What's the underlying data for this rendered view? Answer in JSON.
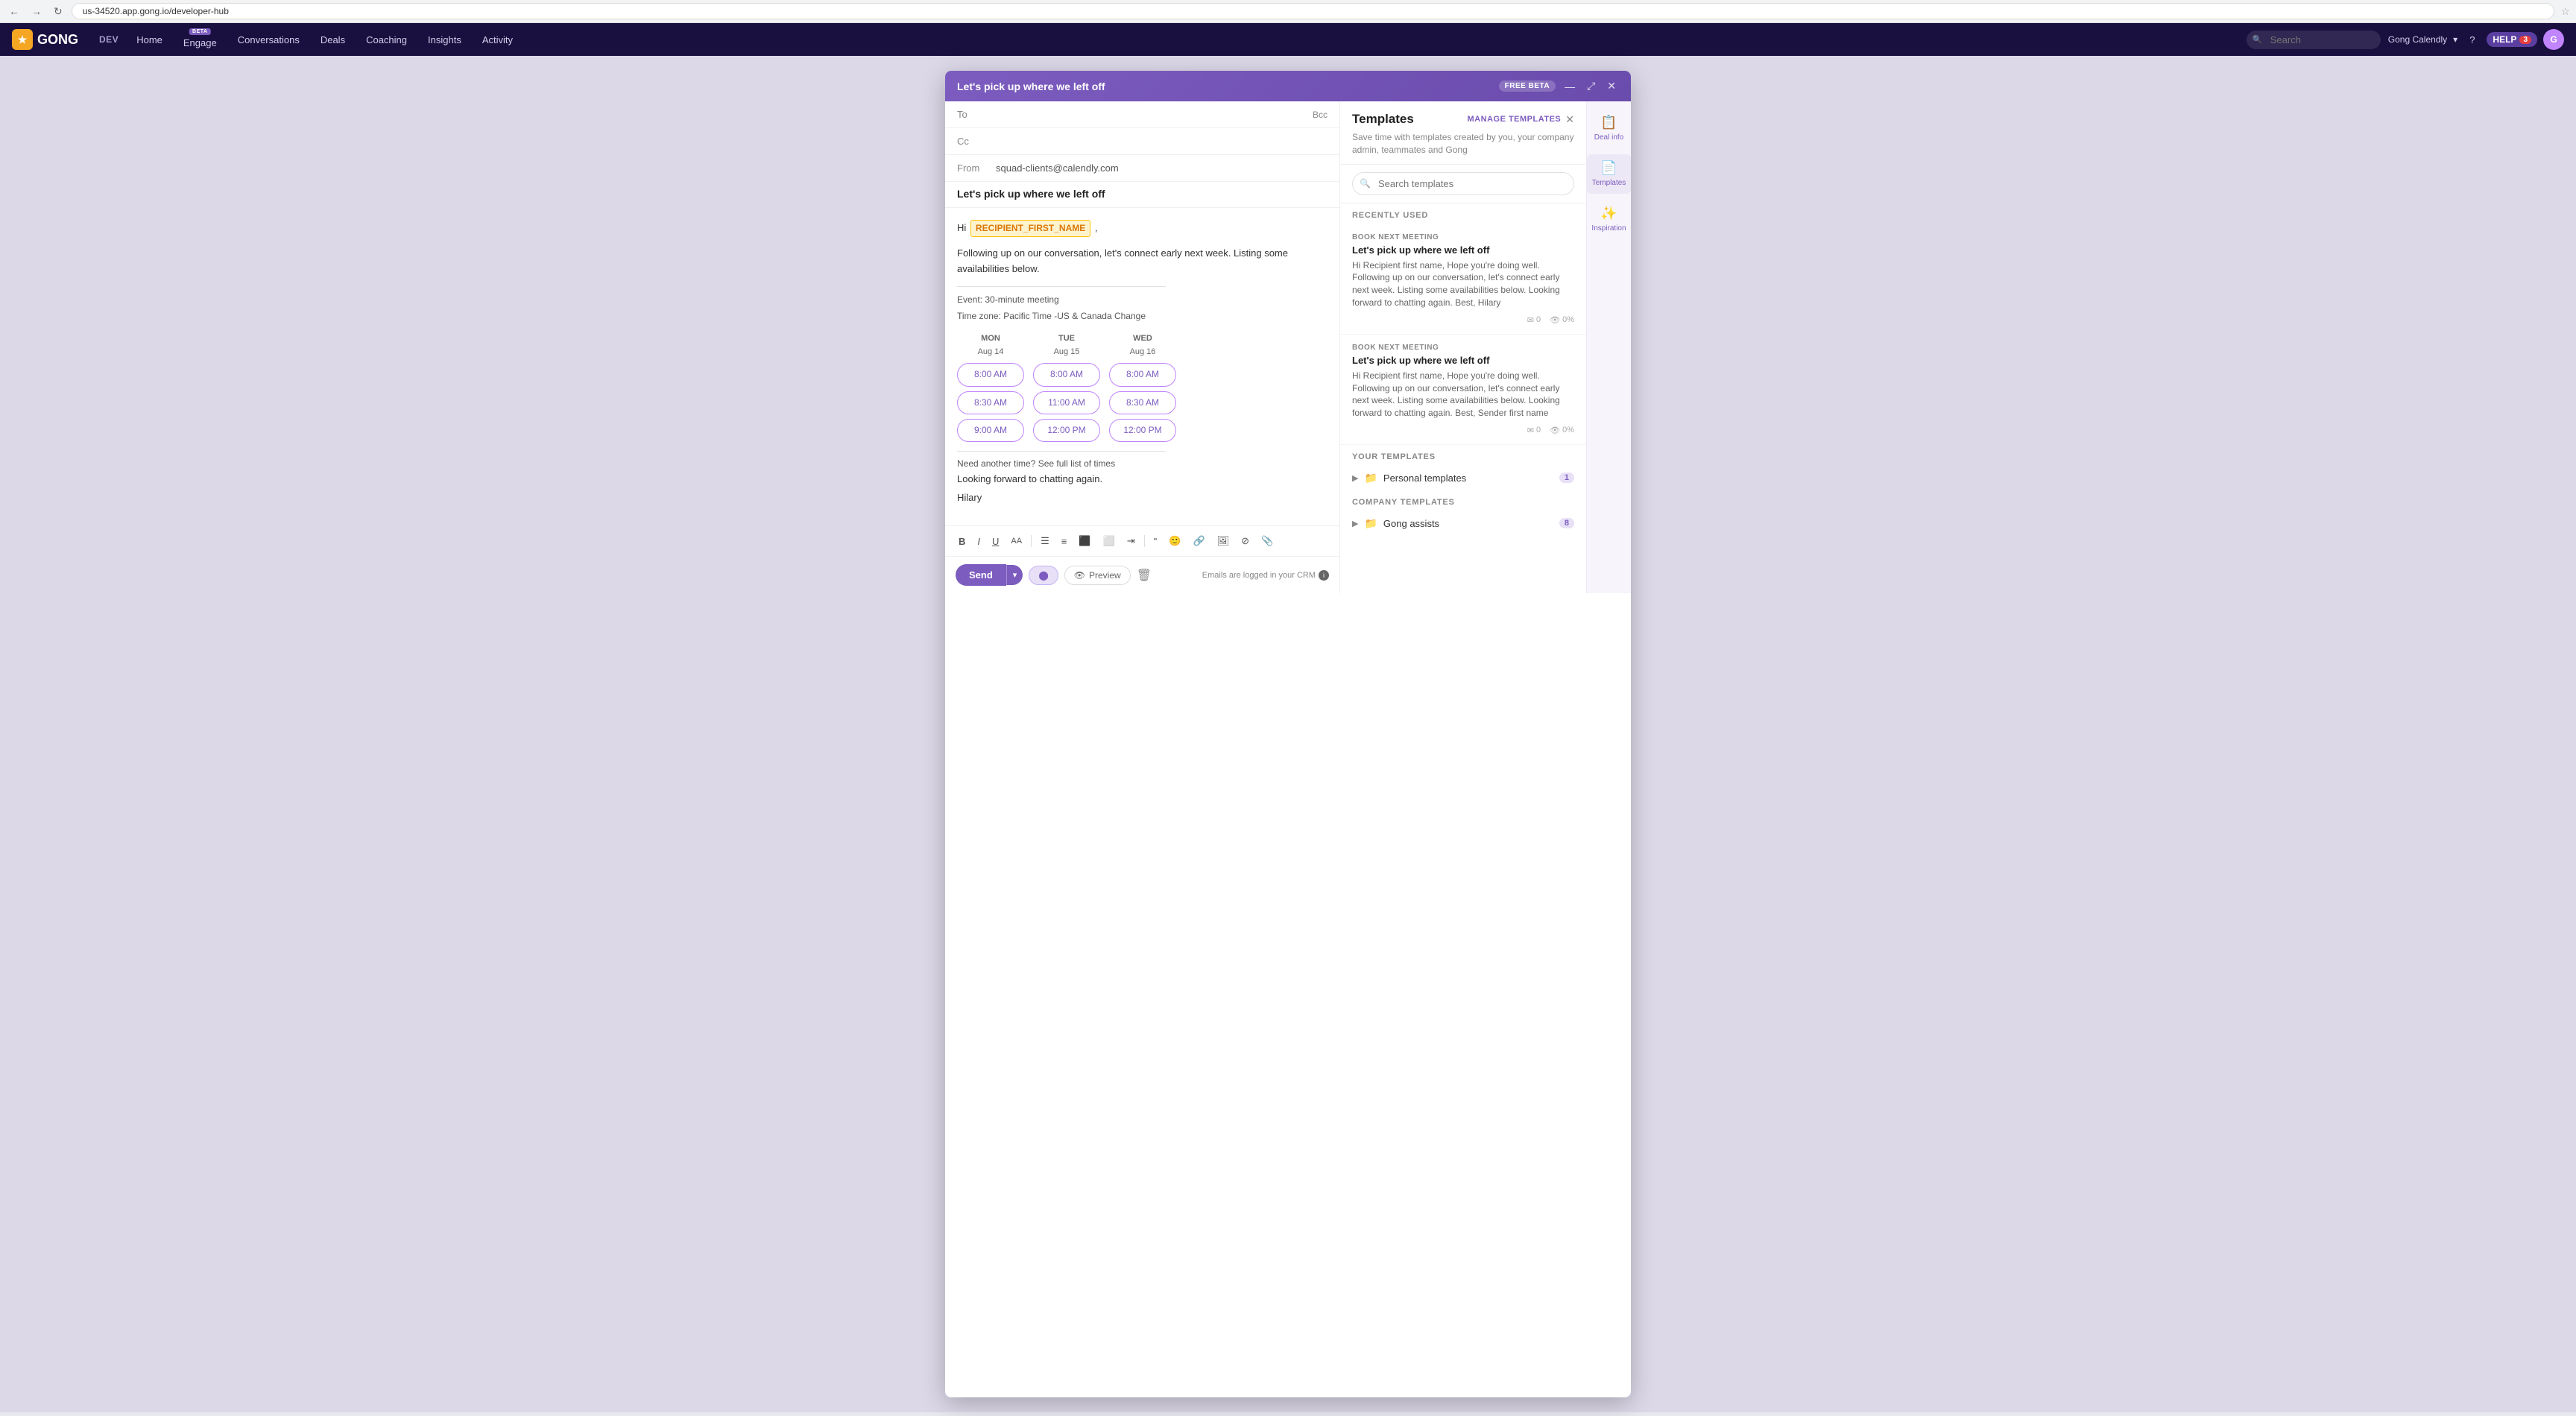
{
  "browser": {
    "url": "us-34520.app.gong.io/developer-hub",
    "back_btn": "←",
    "forward_btn": "→",
    "refresh_btn": "↻"
  },
  "nav": {
    "logo_text": "GONG",
    "env_label": "DEV",
    "items": [
      {
        "label": "Home",
        "beta": false
      },
      {
        "label": "Engage",
        "beta": true
      },
      {
        "label": "Conversations",
        "beta": false
      },
      {
        "label": "Deals",
        "beta": false
      },
      {
        "label": "Coaching",
        "beta": false
      },
      {
        "label": "Insights",
        "beta": false
      },
      {
        "label": "Activity",
        "beta": false
      }
    ],
    "search_placeholder": "Search",
    "user_name": "Gong Calendly",
    "help_label": "HELP",
    "help_count": "3"
  },
  "modal": {
    "title": "Let's pick up where we left off",
    "free_beta": "FREE BETA",
    "compose": {
      "to_label": "To",
      "cc_label": "Cc",
      "bcc_label": "Bcc",
      "from_label": "From",
      "from_email": "squad-clients@calendly.com",
      "subject": "Let's pick up where we left off",
      "greeting": "Hi",
      "recipient_tag": "RECIPIENT_FIRST_NAME",
      "body_line1": "Following up on our conversation, let's connect early next week. Listing some availabilities below.",
      "event_label": "Event: 30-minute meeting",
      "timezone_label": "Time zone: Pacific Time -US & Canada Change",
      "availability": {
        "days": [
          {
            "day": "MON",
            "date": "Aug 14"
          },
          {
            "day": "TUE",
            "date": "Aug 15"
          },
          {
            "day": "WED",
            "date": "Aug 16"
          }
        ],
        "slots": [
          [
            "8:00 AM",
            "8:00 AM",
            "8:00 AM"
          ],
          [
            "8:30 AM",
            "11:00 AM",
            "8:30 AM"
          ],
          [
            "9:00 AM",
            "12:00 PM",
            "12:00 PM"
          ]
        ]
      },
      "need_another": "Need another time? See full list of times",
      "closing_line": "Looking forward to chatting again.",
      "signature": "Hilary",
      "toolbar": {
        "bold": "B",
        "italic": "I",
        "underline": "U",
        "font_size": "AA",
        "bullet_list": "☰",
        "numbered_list": "≡",
        "align_left": "⬛",
        "align_center": "⬜",
        "indent": "⟶",
        "quote": "❝",
        "emoji": "😊",
        "link": "🔗",
        "image": "🖼",
        "clear": "⊘",
        "attachment": "📎"
      },
      "send_label": "Send",
      "preview_label": "Preview",
      "logged_msg": "Emails are logged in your CRM"
    },
    "templates": {
      "title": "Templates",
      "manage_label": "MANAGE TEMPLATES",
      "subtitle": "Save time with templates created by you, your company admin, teammates and Gong",
      "search_placeholder": "Search templates",
      "recently_used_label": "RECENTLY USED",
      "cards": [
        {
          "category": "BOOK NEXT MEETING",
          "name": "Let's pick up where we left off",
          "preview": "Hi Recipient first name, Hope you're doing well. Following up on our conversation, let's connect early next week. Listing some availabilities below. Looking forward to chatting again. Best, Hilary",
          "stat_send": "0",
          "stat_open": "0%"
        },
        {
          "category": "BOOK NEXT MEETING",
          "name": "Let's pick up where we left off",
          "preview": "Hi Recipient first name, Hope you're doing well. Following up on our conversation, let's connect early next week. Listing some availabilities below. Looking forward to chatting again. Best, Sender first name",
          "stat_send": "0",
          "stat_open": "0%"
        }
      ],
      "your_templates_label": "YOUR TEMPLATES",
      "personal_templates_label": "Personal templates",
      "personal_templates_count": "1",
      "company_templates_label": "COMPANY TEMPLATES",
      "gong_assists_label": "Gong assists",
      "gong_assists_count": "8"
    }
  },
  "right_sidebar": {
    "deal_info_label": "Deal info",
    "templates_label": "Templates",
    "inspiration_label": "Inspiration"
  }
}
